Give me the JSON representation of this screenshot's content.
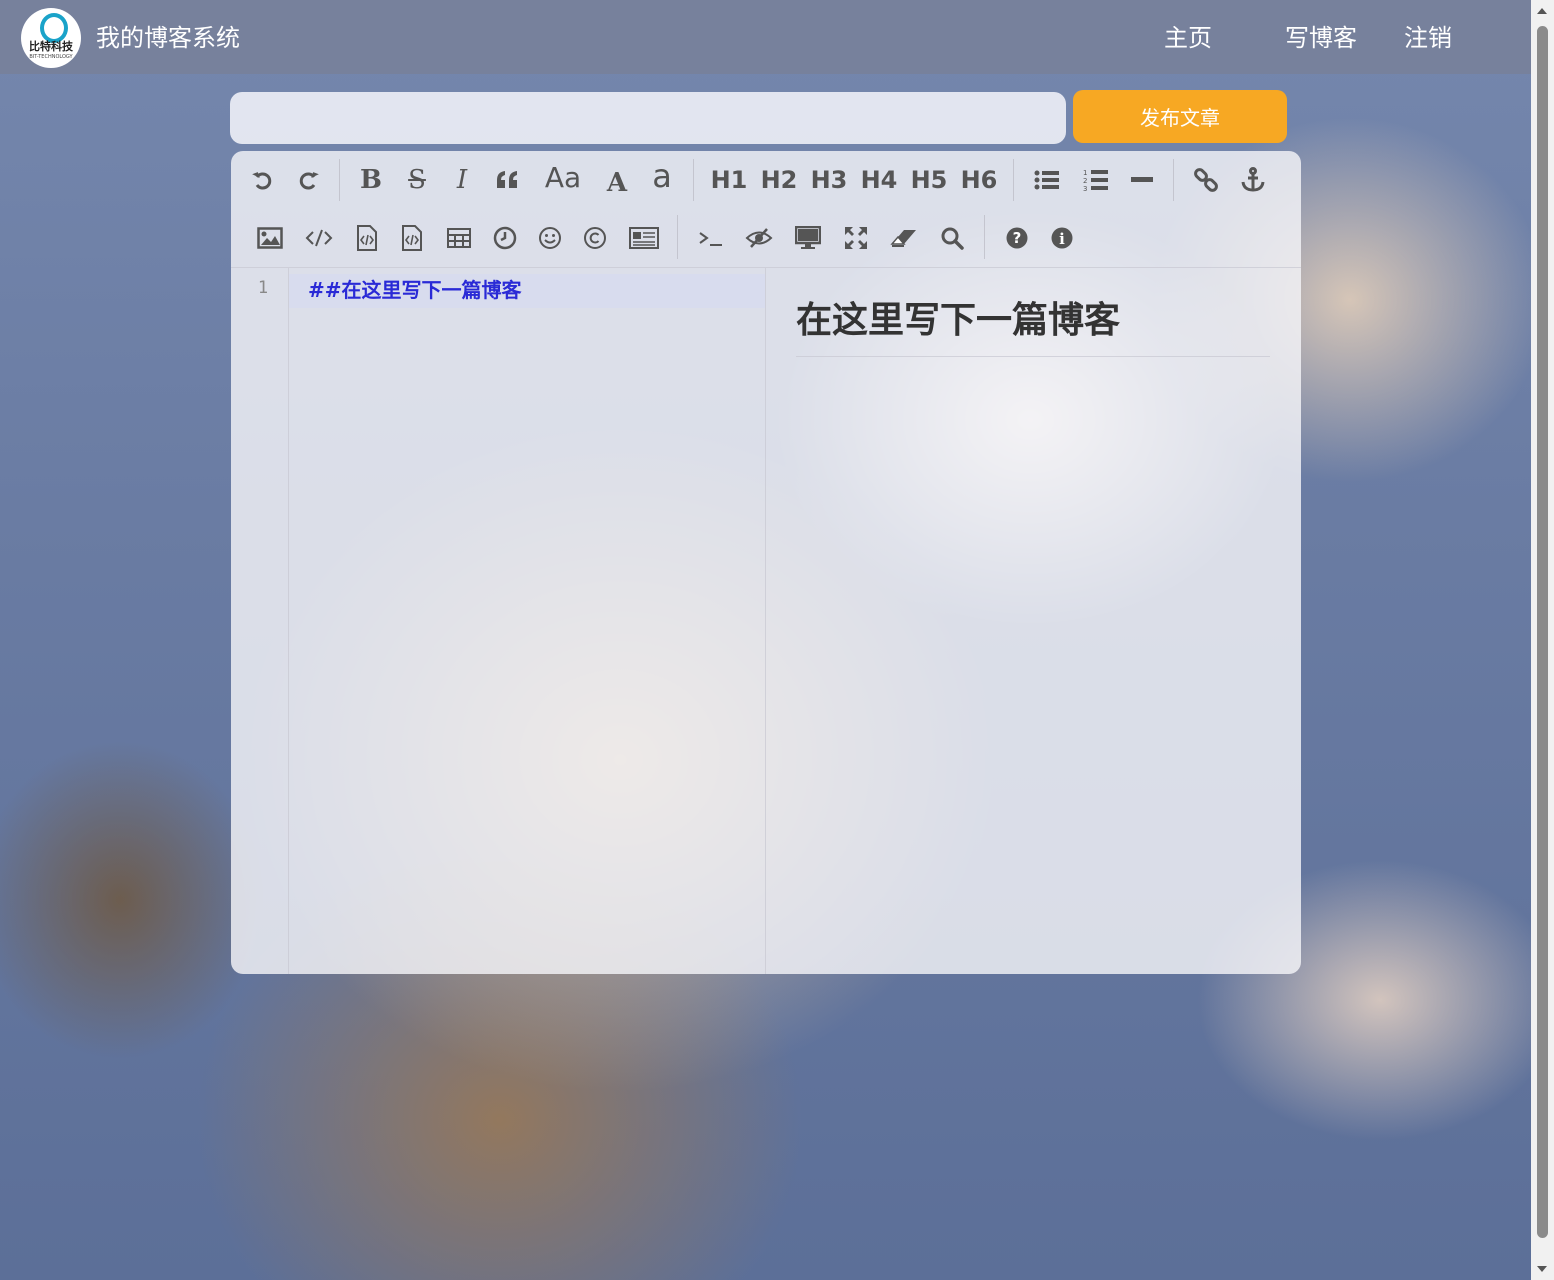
{
  "header": {
    "logo": {
      "text": "比特科技",
      "subtext": "BIT-TECHNOLOGY"
    },
    "site_title": "我的博客系统",
    "nav": [
      "主页",
      "写博客",
      "注销"
    ]
  },
  "title_input": {
    "value": "",
    "placeholder": ""
  },
  "publish_button": {
    "label": "发布文章"
  },
  "colors": {
    "publish": "#f7a823",
    "code_text": "#2a2ad6"
  },
  "toolbar": {
    "row1": [
      {
        "icon": "undo-icon"
      },
      {
        "icon": "redo-icon"
      },
      {
        "icon": "bold-icon",
        "glyph": "B"
      },
      {
        "icon": "strikethrough-icon",
        "glyph": "S"
      },
      {
        "icon": "italic-icon",
        "glyph": "I"
      },
      {
        "icon": "quote-icon",
        "glyph": "“"
      },
      {
        "icon": "uppercase-icon",
        "glyph": "Aa"
      },
      {
        "icon": "uppercase-a-icon",
        "glyph": "A"
      },
      {
        "icon": "lowercase-icon",
        "glyph": "a"
      },
      {
        "label": "H1"
      },
      {
        "label": "H2"
      },
      {
        "label": "H3"
      },
      {
        "label": "H4"
      },
      {
        "label": "H5"
      },
      {
        "label": "H6"
      },
      {
        "icon": "unordered-list-icon"
      },
      {
        "icon": "ordered-list-icon"
      },
      {
        "icon": "horizontal-rule-icon"
      },
      {
        "icon": "link-icon"
      },
      {
        "icon": "anchor-icon"
      }
    ],
    "row2": [
      {
        "icon": "image-icon"
      },
      {
        "icon": "code-icon"
      },
      {
        "icon": "preformatted-text-icon"
      },
      {
        "icon": "code-block-icon"
      },
      {
        "icon": "table-icon"
      },
      {
        "icon": "datetime-icon"
      },
      {
        "icon": "emoji-icon"
      },
      {
        "icon": "html-entities-icon"
      },
      {
        "icon": "pagebreak-icon"
      },
      {
        "icon": "goto-line-icon"
      },
      {
        "icon": "watch-toggle-icon"
      },
      {
        "icon": "preview-icon"
      },
      {
        "icon": "fullscreen-icon"
      },
      {
        "icon": "clear-icon"
      },
      {
        "icon": "search-icon"
      },
      {
        "icon": "help-icon"
      },
      {
        "icon": "info-icon"
      }
    ]
  },
  "editor": {
    "line_numbers": [
      "1"
    ],
    "content": "##在这里写下一篇博客"
  },
  "preview": {
    "heading": "在这里写下一篇博客"
  }
}
